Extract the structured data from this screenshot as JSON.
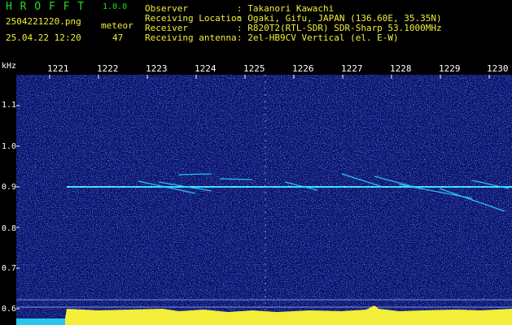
{
  "app": {
    "name": "H R O F F T",
    "version": "1.0.0"
  },
  "file": {
    "name": "2504221220.png",
    "datetime": "25.04.22 12:20"
  },
  "meteor": {
    "label": "meteor",
    "count": "47"
  },
  "info": [
    {
      "key": "Observer",
      "value": ": Takanori Kawachi"
    },
    {
      "key": "Receiving Location",
      "value": ": Ogaki, Gifu, JAPAN (136.60E, 35.35N)"
    },
    {
      "key": "Receiver",
      "value": ": R820T2(RTL-SDR) SDR-Sharp 53.1000MHz"
    },
    {
      "key": "Receiving antenna",
      "value": ": 2el-HB9CV Vertical (el. E-W)"
    }
  ],
  "axis": {
    "y_unit": "kHz",
    "y_ticks": [
      "1.1",
      "1.0",
      "0.9",
      "0.8",
      "0.7",
      "0.6"
    ],
    "x_ticks": [
      "1221",
      "1222",
      "1223",
      "1224",
      "1225",
      "1226",
      "1227",
      "1228",
      "1229",
      "1230"
    ]
  },
  "colors": {
    "green": "#22dd22",
    "yellow": "#f2ee3a",
    "background": "#0a0f6a",
    "signal": "#35e0ff"
  }
}
